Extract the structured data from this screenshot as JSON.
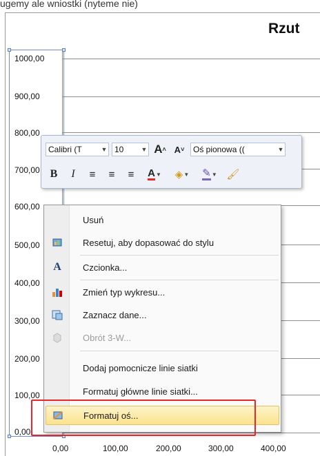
{
  "cropped_header_text": "ugemy ale wniostki (nyteme nie)",
  "chart": {
    "title": "Rzut",
    "y_ticks": [
      "1000,00",
      "900,00",
      "800,00",
      "700,00",
      "600,00",
      "500,00",
      "400,00",
      "300,00",
      "200,00",
      "100,00",
      "0,00"
    ],
    "x_ticks": [
      "0,00",
      "100,00",
      "200,00",
      "300,00",
      "400,00"
    ]
  },
  "mini_toolbar": {
    "font_name": "Calibri (T",
    "font_size": "10",
    "element_selector": "Oś pionowa ((",
    "grow_font_label": "A",
    "shrink_font_label": "A",
    "bold_label": "B",
    "italic_label": "I",
    "font_color_label": "A"
  },
  "context_menu": {
    "items": [
      {
        "label": "Usuń",
        "icon": "none",
        "disabled": false
      },
      {
        "label": "Resetuj, aby dopasować do stylu",
        "icon": "reset-style-icon",
        "disabled": false
      },
      {
        "label": "Czcionka...",
        "icon": "font-icon",
        "disabled": false
      },
      {
        "label": "Zmień typ wykresu...",
        "icon": "chart-type-icon",
        "disabled": false
      },
      {
        "label": "Zaznacz dane...",
        "icon": "select-data-icon",
        "disabled": false
      },
      {
        "label": "Obrót 3-W...",
        "icon": "rotation-3d-icon",
        "disabled": true
      },
      {
        "label": "Dodaj pomocnicze linie siatki",
        "icon": "none",
        "disabled": false
      },
      {
        "label": "Formatuj główne linie siatki...",
        "icon": "none",
        "disabled": false
      },
      {
        "label": "Formatuj oś...",
        "icon": "format-axis-icon",
        "disabled": false,
        "highlighted": true
      }
    ]
  },
  "colors": {
    "highlight_fill": "#fbe38e",
    "callout_red": "#e8262a",
    "font_color_red": "#e8262a"
  }
}
